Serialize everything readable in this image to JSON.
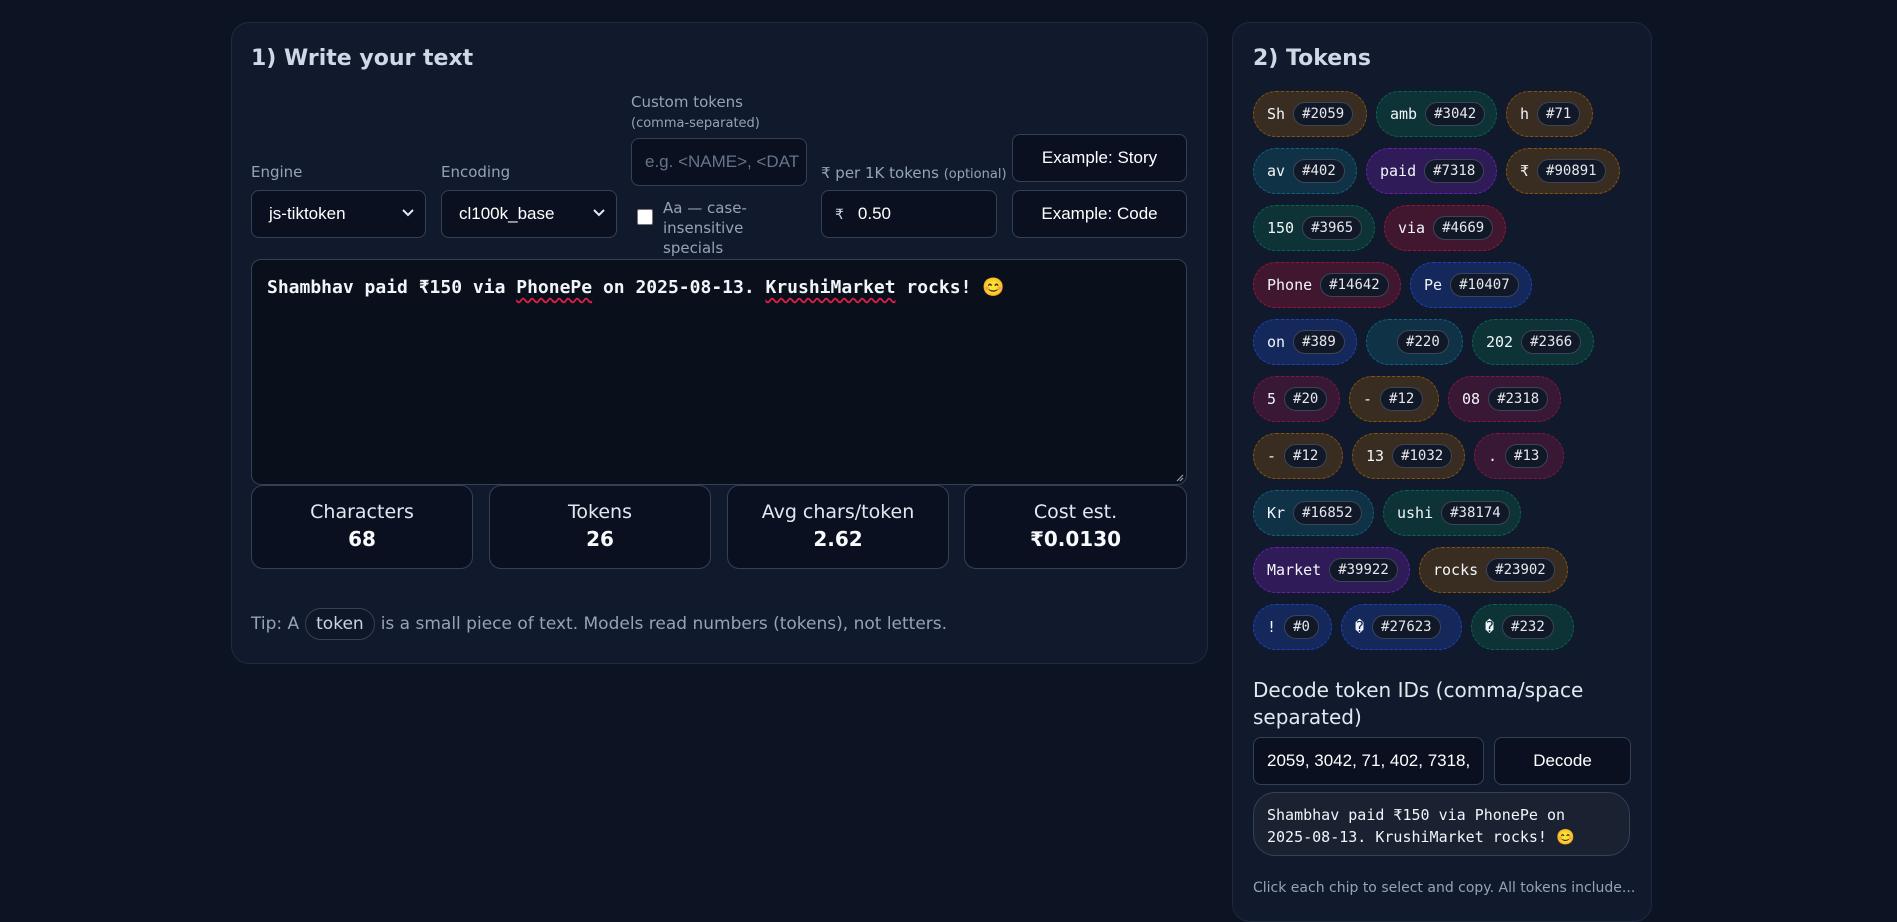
{
  "left": {
    "title": "1) Write your text",
    "engine": {
      "label": "Engine",
      "value": "js-tiktoken"
    },
    "encoding": {
      "label": "Encoding",
      "value": "cl100k_base"
    },
    "custom_tokens": {
      "label": "Custom tokens",
      "label_hint": "(comma-separated)",
      "placeholder": "e.g. <NAME>, <DAT"
    },
    "case_insensitive": {
      "label": "Aa — case-insensitive specials",
      "checked": false
    },
    "cost": {
      "label": "₹ per 1K tokens",
      "label_hint": "(optional)",
      "currency": "₹",
      "value": "0.50"
    },
    "example_story": "Example: Story",
    "example_code": "Example: Code",
    "text": {
      "part1": "Shambhav paid ₹150 via ",
      "word1": "PhonePe",
      "part2": " on 2025-08-13. ",
      "word2": "KrushiMarket",
      "part3": " rocks! 😊"
    },
    "stats": [
      {
        "label": "Characters",
        "value": "68"
      },
      {
        "label": "Tokens",
        "value": "26"
      },
      {
        "label": "Avg chars/token",
        "value": "2.62"
      },
      {
        "label": "Cost est.",
        "value": "₹0.0130"
      }
    ],
    "tip": {
      "before": "Tip: A",
      "chip": "token",
      "after": "is a small piece of text. Models read numbers (tokens), not letters."
    }
  },
  "right": {
    "title": "2) Tokens",
    "tokens": [
      {
        "text": "Sh",
        "id": "#2059",
        "color": "#a16207"
      },
      {
        "text": "amb",
        "id": "#3042",
        "color": "#047857"
      },
      {
        "text": "h",
        "id": "#71",
        "color": "#a16207"
      },
      {
        "text": "av",
        "id": "#402",
        "color": "#0e7490"
      },
      {
        "text": "paid",
        "id": "#7318",
        "color": "#7e22ce"
      },
      {
        "text": "₹",
        "id": "#90891",
        "color": "#a16207"
      },
      {
        "text": "150",
        "id": "#3965",
        "color": "#047857"
      },
      {
        "text": "via",
        "id": "#4669",
        "color": "#be123c"
      },
      {
        "text": "Phone",
        "id": "#14642",
        "color": "#be123c"
      },
      {
        "text": "Pe",
        "id": "#10407",
        "color": "#1d4ed8"
      },
      {
        "text": "on",
        "id": "#389",
        "color": "#1d4ed8"
      },
      {
        "text": " ",
        "id": "#220",
        "color": "#0e7490"
      },
      {
        "text": "202",
        "id": "#2366",
        "color": "#047857"
      },
      {
        "text": "5",
        "id": "#20",
        "color": "#9d174d"
      },
      {
        "text": "-",
        "id": "#12",
        "color": "#a16207"
      },
      {
        "text": "08",
        "id": "#2318",
        "color": "#9d174d"
      },
      {
        "text": "-",
        "id": "#12",
        "color": "#a16207"
      },
      {
        "text": "13",
        "id": "#1032",
        "color": "#a16207"
      },
      {
        "text": ".",
        "id": "#13",
        "color": "#9d174d"
      },
      {
        "text": "Kr",
        "id": "#16852",
        "color": "#0e7490"
      },
      {
        "text": "ushi",
        "id": "#38174",
        "color": "#047857"
      },
      {
        "text": "Market",
        "id": "#39922",
        "color": "#7e22ce"
      },
      {
        "text": "rocks",
        "id": "#23902",
        "color": "#a16207"
      },
      {
        "text": "!",
        "id": "#0",
        "color": "#1d4ed8"
      },
      {
        "text": "�",
        "id": "#27623",
        "color": "#1d4ed8"
      },
      {
        "text": "�",
        "id": "#232",
        "color": "#047857"
      }
    ],
    "decode": {
      "label": "Decode token IDs (comma/space separated)",
      "input_value": "2059, 3042, 71, 402, 7318,",
      "button": "Decode",
      "output": "Shambhav paid ₹150 via PhonePe on 2025-08-13. KrushiMarket rocks! 😊"
    },
    "footer": "Click each chip to select and copy. All tokens include..."
  }
}
